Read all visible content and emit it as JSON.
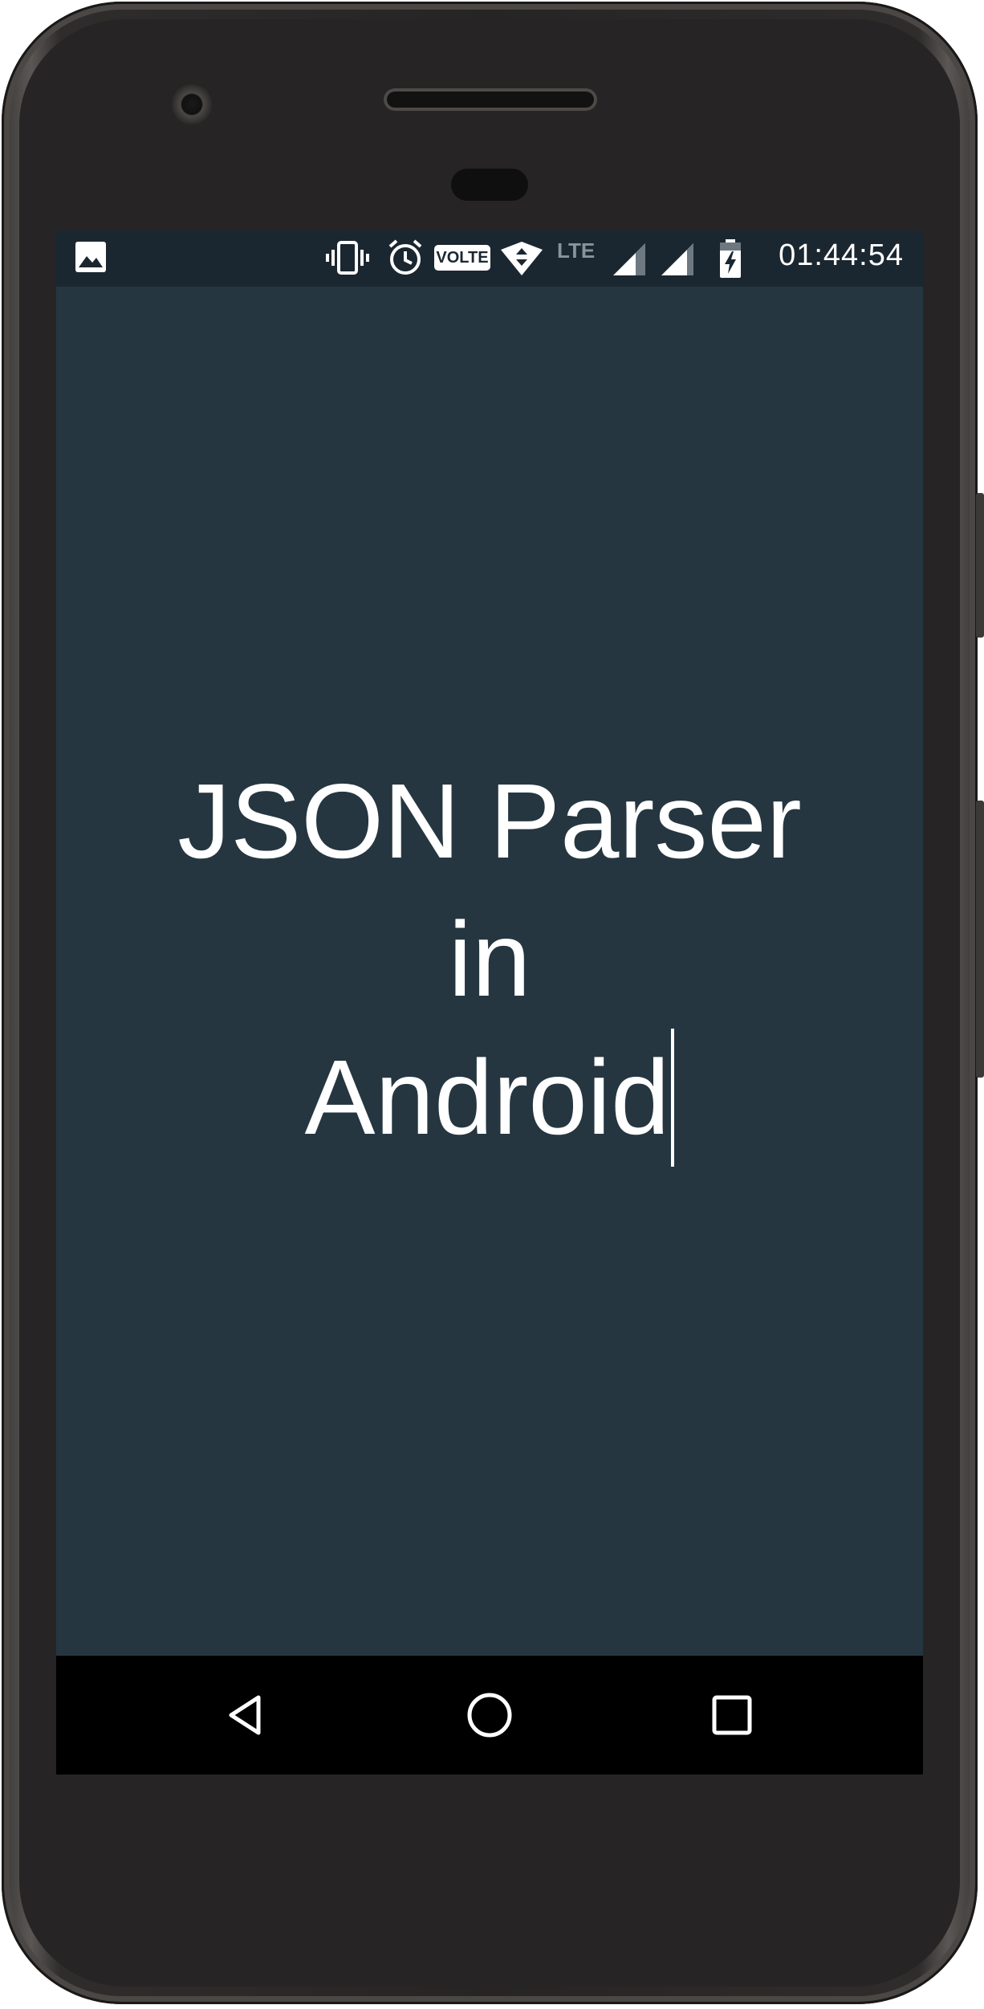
{
  "status_bar": {
    "time": "01:44:54",
    "network_type": "LTE",
    "volte_badge": "VOLTE",
    "icons": [
      "image-notification-icon",
      "vibrate-icon",
      "alarm-icon",
      "volte-icon",
      "wifi-icon",
      "signal-icon",
      "signal-icon",
      "battery-charging-icon"
    ]
  },
  "main": {
    "title_lines": [
      "JSON Parser",
      "in",
      "Android"
    ]
  },
  "nav_bar": {
    "buttons": [
      "back-icon",
      "home-icon",
      "recent-apps-icon"
    ]
  },
  "colors": {
    "background": "#253640",
    "status_bar": "#1b2730",
    "nav_bar": "#000000",
    "text": "#ffffff"
  }
}
